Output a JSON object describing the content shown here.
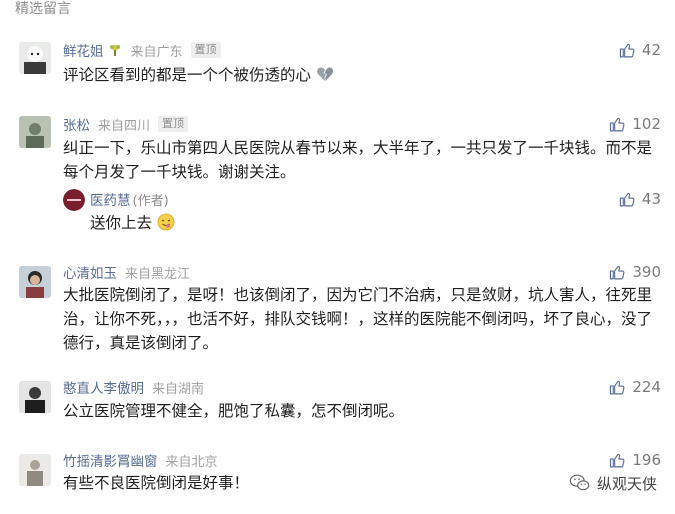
{
  "section": {
    "title": "精选留言"
  },
  "comments": [
    {
      "nickname": "鲜花姐",
      "location": "来自广东",
      "pinned": "置顶",
      "likes": "42",
      "text": "评论区看到的都是一个个被伤透的心",
      "badge_icon": "flower-badge-icon",
      "emoji": "broken-heart-icon"
    },
    {
      "nickname": "张松",
      "location": "来自四川",
      "pinned": "置顶",
      "likes": "102",
      "text": "纠正一下，乐山市第四人民医院从春节以来，大半年了，一共只发了一千块钱。而不是每个月发了一千块钱。谢谢关注。",
      "reply": {
        "nickname": "医药慧",
        "role": "(作者)",
        "likes": "43",
        "text": "送你上去",
        "emoji": "tongue-out-emoji-icon"
      }
    },
    {
      "nickname": "心清如玉",
      "location": "来自黑龙江",
      "likes": "390",
      "text": "大批医院倒闭了，是呀！也该倒闭了，因为它门不治病，只是敛财，坑人害人，往死里治，让你不死，，，也活不好，排队交钱啊！，这样的医院能不倒闭吗，坏了良心，没了德行，真是该倒闭了。"
    },
    {
      "nickname": "憨直人李傲明",
      "location": "来自湖南",
      "likes": "224",
      "text": "公立医院管理不健全，肥饱了私囊，怎不倒闭呢。"
    },
    {
      "nickname": "竹摇清影罥幽窗",
      "location": "来自北京",
      "likes": "196",
      "text": "有些不良医院倒闭是好事！"
    }
  ],
  "watermark": {
    "label": "纵观天侠",
    "icon": "wechat-icon"
  },
  "colors": {
    "nickname": "#576b95",
    "meta": "#a0a0a0",
    "text": "#1f1f1f"
  }
}
